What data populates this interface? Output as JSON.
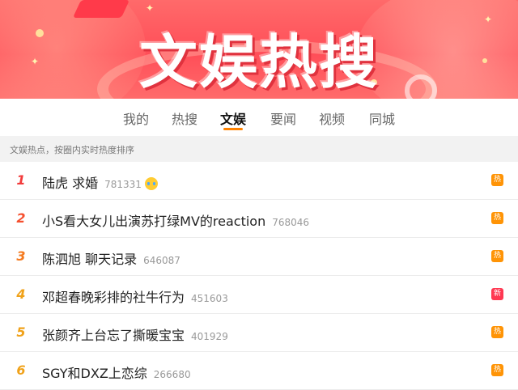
{
  "banner": {
    "title": "文娱热搜"
  },
  "tabs": [
    {
      "label": "我的"
    },
    {
      "label": "热搜"
    },
    {
      "label": "文娱",
      "active": true
    },
    {
      "label": "要闻"
    },
    {
      "label": "视频"
    },
    {
      "label": "同城"
    }
  ],
  "subheader": "文娱热点，按圈内实时热度排序",
  "items": [
    {
      "rank": "1",
      "title": "陆虎 求婚",
      "count": "781331",
      "emoji": "crying-face-icon",
      "badge": "热",
      "badge_type": "hot"
    },
    {
      "rank": "2",
      "title": "小S看大女儿出演苏打绿MV的reaction",
      "count": "768046",
      "badge": "热",
      "badge_type": "hot"
    },
    {
      "rank": "3",
      "title": "陈泗旭 聊天记录",
      "count": "646087",
      "badge": "热",
      "badge_type": "hot"
    },
    {
      "rank": "4",
      "title": "邓超春晚彩排的社牛行为",
      "count": "451603",
      "badge": "新",
      "badge_type": "new"
    },
    {
      "rank": "5",
      "title": "张颜齐上台忘了撕暖宝宝",
      "count": "401929",
      "badge": "热",
      "badge_type": "hot"
    },
    {
      "rank": "6",
      "title": "SGY和DXZ上恋综",
      "count": "266680",
      "badge": "热",
      "badge_type": "hot"
    }
  ],
  "colors": {
    "accent": "#ff8200",
    "hot_badge": "#ff9406",
    "new_badge": "#ff3852",
    "banner": "#ff5a60"
  }
}
